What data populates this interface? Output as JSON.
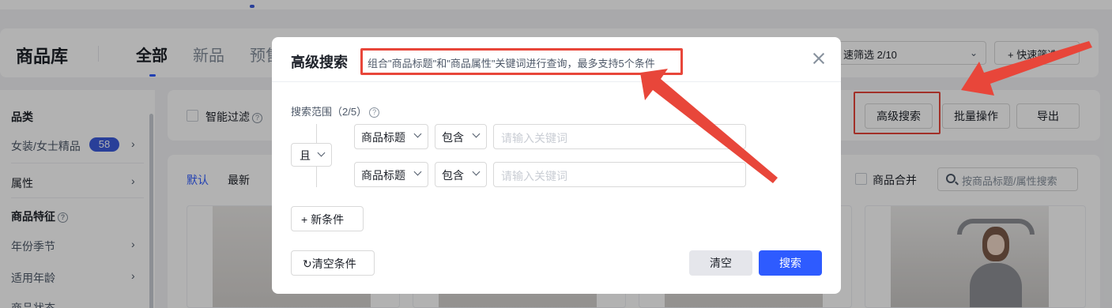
{
  "header": {
    "title": "商品库",
    "tabs": [
      {
        "label": "全部",
        "active": true
      },
      {
        "label": "新品",
        "active": false
      },
      {
        "label": "预售",
        "active": false
      }
    ],
    "quick_filter_select": "速筛选 2/10",
    "quick_filter_button": "+ 快速筛选"
  },
  "sidebar": {
    "category_head": "品类",
    "category_item": "女装/女士精品",
    "category_count": "58",
    "attribute_head": "属性",
    "feature_head": "商品特征",
    "feature_items": [
      "年份季节",
      "适用年龄",
      "商品状态"
    ]
  },
  "filter_bar": {
    "smart_filter_label": "智能过滤",
    "advanced_search_button": "高级搜索",
    "batch_button": "批量操作",
    "export_button": "导出"
  },
  "list": {
    "sort_tabs": [
      "默认",
      "最新"
    ],
    "merge_label": "商品合并",
    "search_placeholder": "按商品标题/属性搜索"
  },
  "modal": {
    "title": "高级搜索",
    "subtitle": "组合\"商品标题\"和\"商品属性\"关键词进行查询，最多支持5个条件",
    "scope_label": "搜索范围（2/5）",
    "logic_operator": "且",
    "conditions": [
      {
        "field": "商品标题",
        "operator": "包含",
        "placeholder": "请输入关键词"
      },
      {
        "field": "商品标题",
        "operator": "包含",
        "placeholder": "请输入关键词"
      }
    ],
    "new_condition_button": "+ 新条件",
    "clear_conditions_button": "清空条件",
    "clear_button": "清空",
    "search_button": "搜索"
  },
  "colors": {
    "primary": "#2e5bff",
    "highlight_red": "#e8463a",
    "badge_blue": "#3b5bdb"
  }
}
